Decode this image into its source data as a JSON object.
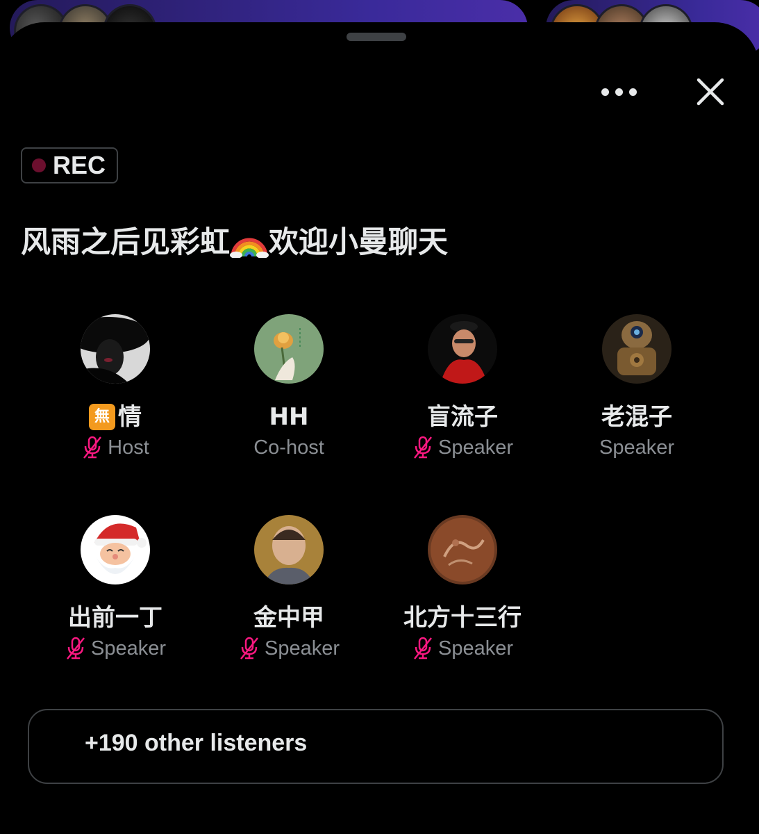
{
  "space": {
    "recording_label": "REC",
    "title": "风雨之后见彩虹",
    "title_emoji": "rainbow-icon",
    "title_suffix": "欢迎小曼聊天"
  },
  "participants": [
    {
      "name": "情",
      "badge": "無",
      "role": "Host",
      "muted": true,
      "avatar": "woman-in-black-hat-avatar"
    },
    {
      "name": "HH",
      "role": "Co-host",
      "muted": false,
      "avatar": "lotus-flower-avatar"
    },
    {
      "name": "盲流子",
      "role": "Speaker",
      "muted": true,
      "avatar": "man-red-scarf-avatar"
    },
    {
      "name": "老混子",
      "role": "Speaker",
      "muted": false,
      "avatar": "steampunk-robot-avatar"
    },
    {
      "name": "出前一丁",
      "role": "Speaker",
      "muted": true,
      "avatar": "santa-claus-avatar"
    },
    {
      "name": "金中甲",
      "role": "Speaker",
      "muted": true,
      "avatar": "bald-man-avatar"
    },
    {
      "name": "北方十三行",
      "role": "Speaker",
      "muted": true,
      "avatar": "bronze-coin-avatar"
    }
  ],
  "listeners": {
    "label": "+190 other listeners"
  },
  "colors": {
    "muted_mic": "#f91880",
    "role_text": "#8b8f94",
    "rec_dot": "#6b0f2e",
    "badge": "#f39a1e"
  }
}
